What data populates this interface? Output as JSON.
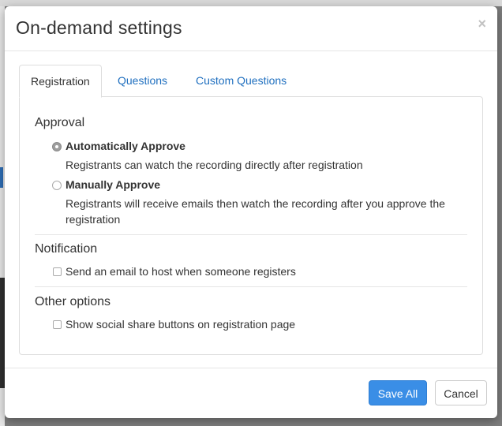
{
  "dialog": {
    "title": "On-demand settings",
    "close_glyph": "×"
  },
  "tabs": [
    {
      "label": "Registration",
      "active": true
    },
    {
      "label": "Questions",
      "active": false
    },
    {
      "label": "Custom Questions",
      "active": false
    }
  ],
  "approval": {
    "heading": "Approval",
    "options": [
      {
        "label": "Automatically Approve",
        "selected": true,
        "description": "Registrants can watch the recording directly after registration"
      },
      {
        "label": "Manually Approve",
        "selected": false,
        "description_line1": "Registrants will receive emails then watch the recording after you approve the",
        "description_line2": "registration"
      }
    ]
  },
  "notification": {
    "heading": "Notification",
    "checkbox_label": "Send an email to host when someone registers",
    "checked": false
  },
  "other_options": {
    "heading": "Other options",
    "checkbox_label": "Show social share buttons on registration page",
    "checked": false
  },
  "footer": {
    "save_label": "Save All",
    "cancel_label": "Cancel"
  },
  "colors": {
    "primary": "#3a8ee6",
    "link": "#1f6fbf"
  }
}
